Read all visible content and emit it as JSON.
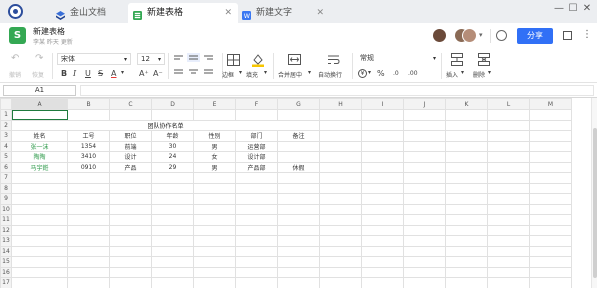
{
  "tabs": [
    {
      "label": "金山文档",
      "icon": "kdocs-icon"
    },
    {
      "label": "新建表格",
      "icon": "sheet-icon",
      "active": true
    },
    {
      "label": "新建文字",
      "icon": "doc-icon"
    }
  ],
  "header": {
    "app_icon_letter": "S",
    "title": "新建表格",
    "subtitle": "李某 昨天 更新",
    "share_label": "分享",
    "more_label": "⋮"
  },
  "toolbar": {
    "undo_label": "撤销",
    "redo_label": "恢复",
    "font_family": "宋体",
    "font_size": "12",
    "bold": "B",
    "italic": "I",
    "underline": "U",
    "strike": "S",
    "font_color": "A",
    "grow_font": "A⁺",
    "shrink_font": "A⁻",
    "border_label": "边框",
    "fill_label": "填充",
    "merge_label": "合并居中",
    "wrap_label": "自动换行",
    "number_format": "常规",
    "insert_label": "插入",
    "delete_label": "删除",
    "currency_symbol": "¥",
    "percent_symbol": "%",
    "decimal_up": ".0",
    "decimal_down": ".00"
  },
  "formula_bar": {
    "cell_ref": "A1",
    "value": ""
  },
  "sheet": {
    "columns": [
      "A",
      "B",
      "C",
      "D",
      "E",
      "F",
      "G",
      "H",
      "I",
      "J",
      "K",
      "L",
      "M"
    ],
    "rows": [
      "1",
      "2",
      "3",
      "4",
      "5",
      "6",
      "7",
      "8",
      "9",
      "10",
      "11",
      "12",
      "13",
      "14",
      "15",
      "16",
      "17"
    ],
    "title": "团队协作名单",
    "headers": [
      "姓名",
      "工号",
      "职位",
      "年龄",
      "性别",
      "部门",
      "备注"
    ],
    "records": [
      [
        "张一沫",
        "1354",
        "前端",
        "30",
        "男",
        "运营部",
        ""
      ],
      [
        "陶陶",
        "3410",
        "设计",
        "24",
        "女",
        "设计部",
        ""
      ],
      [
        "马宇銋",
        "0910",
        "产品",
        "29",
        "男",
        "产品部",
        "休假"
      ]
    ]
  },
  "colors": {
    "accent": "#3170f6",
    "sheet_green": "#34a853",
    "name_green": "#2e9a4a"
  }
}
